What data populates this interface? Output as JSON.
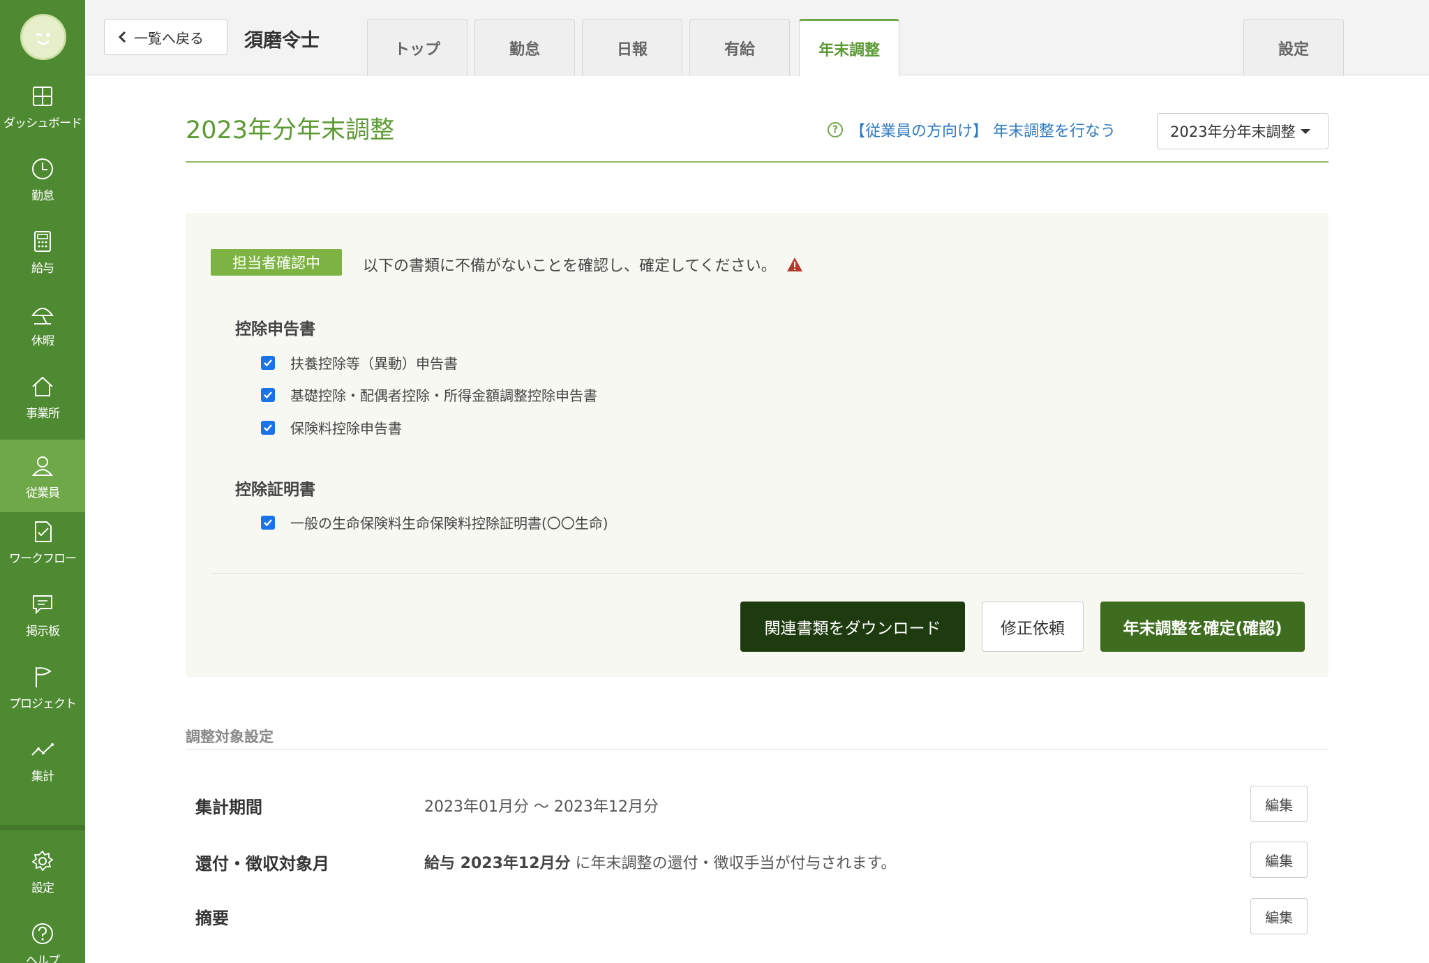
{
  "sidebar": {
    "items": [
      {
        "label": "ダッシュボード",
        "icon": "dashboard-icon"
      },
      {
        "label": "勤怠",
        "icon": "clock-icon"
      },
      {
        "label": "給与",
        "icon": "calculator-icon"
      },
      {
        "label": "休暇",
        "icon": "umbrella-icon"
      },
      {
        "label": "事業所",
        "icon": "home-icon"
      },
      {
        "label": "従業員",
        "icon": "person-icon"
      },
      {
        "label": "ワークフロー",
        "icon": "checklist-icon"
      },
      {
        "label": "掲示板",
        "icon": "chat-icon"
      },
      {
        "label": "プロジェクト",
        "icon": "flag-icon"
      },
      {
        "label": "集計",
        "icon": "line-chart-icon"
      }
    ],
    "active": "従業員",
    "bottom": [
      {
        "label": "設定",
        "icon": "gear-icon"
      },
      {
        "label": "ヘルプ",
        "icon": "help-circle-icon"
      }
    ]
  },
  "header": {
    "back_label": "一覧へ戻る",
    "employee_name": "須磨令士",
    "tabs": [
      "トップ",
      "勤怠",
      "日報",
      "有給",
      "年末調整"
    ],
    "active_tab": "年末調整",
    "settings_tab": "設定"
  },
  "main": {
    "title": "2023年分年末調整",
    "help_link": "【従業員の方向け】 年末調整を行なう",
    "year_select": "2023年分年末調整",
    "status": {
      "badge": "担当者確認中",
      "message": "以下の書類に不備がないことを確認し、確定してください。"
    },
    "sections": [
      {
        "heading": "控除申告書",
        "items": [
          {
            "label": "扶養控除等（異動）申告書",
            "checked": true
          },
          {
            "label": "基礎控除・配偶者控除・所得金額調整控除申告書",
            "checked": true
          },
          {
            "label": "保険料控除申告書",
            "checked": true
          }
        ]
      },
      {
        "heading": "控除証明書",
        "items": [
          {
            "label": "一般の生命保険料生命保険料控除証明書(〇〇生命)",
            "checked": true
          }
        ]
      }
    ],
    "actions": {
      "download": "関連書類をダウンロード",
      "request_fix": "修正依頼",
      "confirm": "年末調整を確定(確認)"
    },
    "settings": {
      "heading": "調整対象設定",
      "rows": [
        {
          "label": "集計期間",
          "value": "2023年01月分 〜 2023年12月分",
          "edit": "編集"
        },
        {
          "label": "還付・徴収対象月",
          "value_bold": "給与 2023年12月分",
          "value": "に年末調整の還付・徴収手当が付与されます。",
          "edit": "編集"
        },
        {
          "label": "摘要",
          "value": "",
          "edit": "編集"
        }
      ]
    }
  },
  "colors": {
    "sidebar": "#4e8a31",
    "sidebar_active": "#6fa848",
    "accent_green": "#5c9a34",
    "badge_green": "#7cb342",
    "dark_button": "#1e3a0f",
    "confirm_button": "#3f6d1f",
    "link_blue": "#2f7ac0",
    "warning_red": "#b03a2e",
    "checkbox_blue": "#1a73e8"
  }
}
